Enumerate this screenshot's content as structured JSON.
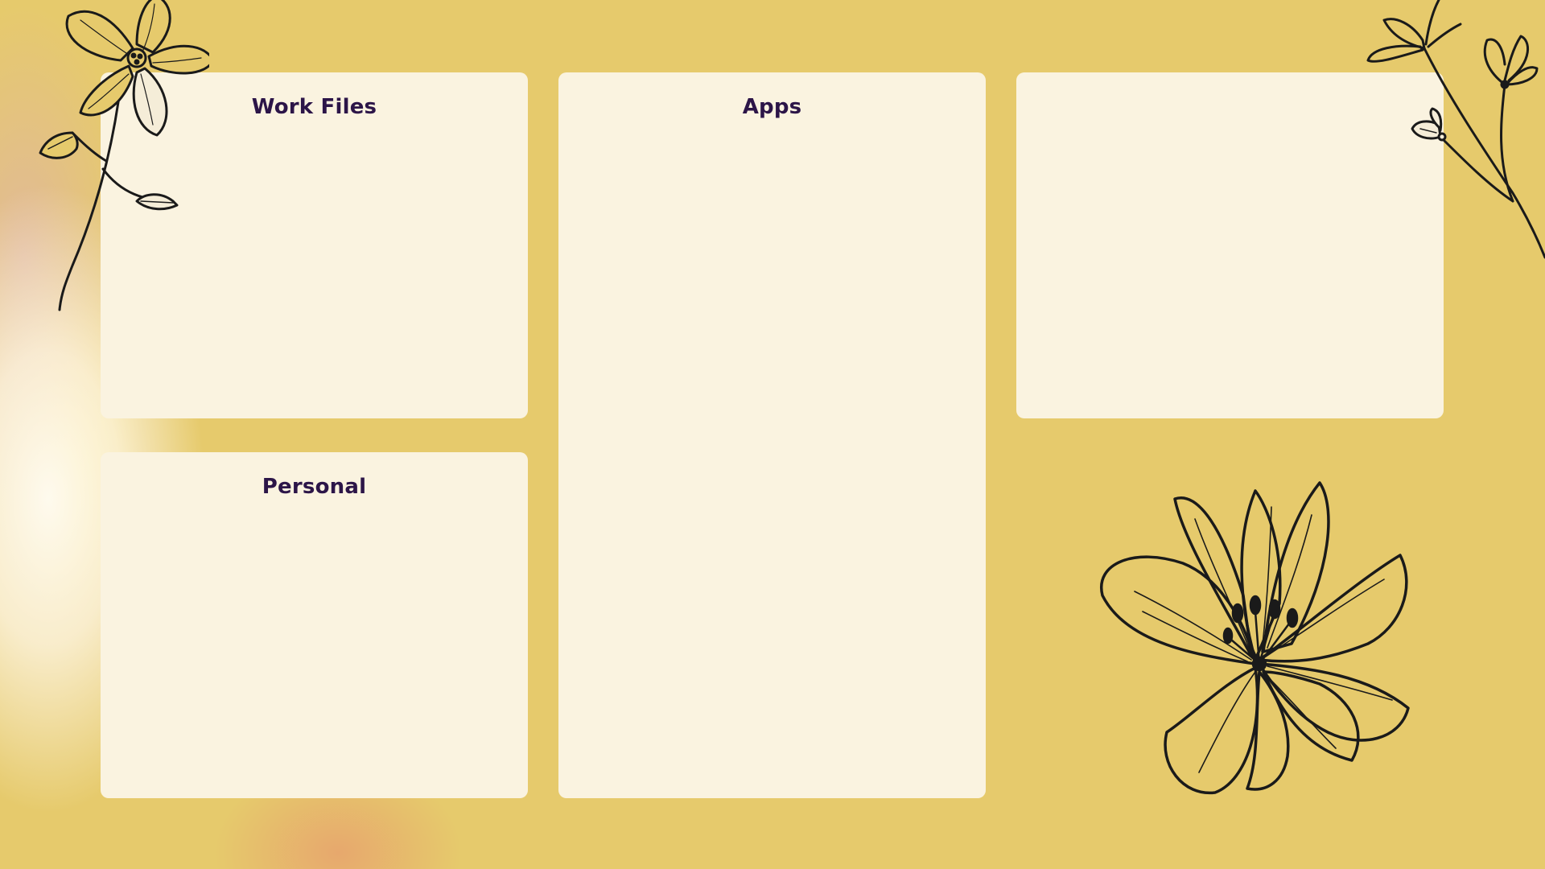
{
  "background": {
    "color": "#e6ca6c",
    "panel_color": "#faf3e0",
    "title_color": "#2c1548"
  },
  "panels": {
    "work_files": {
      "title": "Work Files"
    },
    "apps": {
      "title": "Apps"
    },
    "personal": {
      "title": "Personal"
    },
    "blank": {
      "title": ""
    }
  },
  "decorations": {
    "top_left": "flower-sprig-icon",
    "top_right": "wildflower-branch-icon",
    "bottom_right": "lily-flower-icon"
  }
}
